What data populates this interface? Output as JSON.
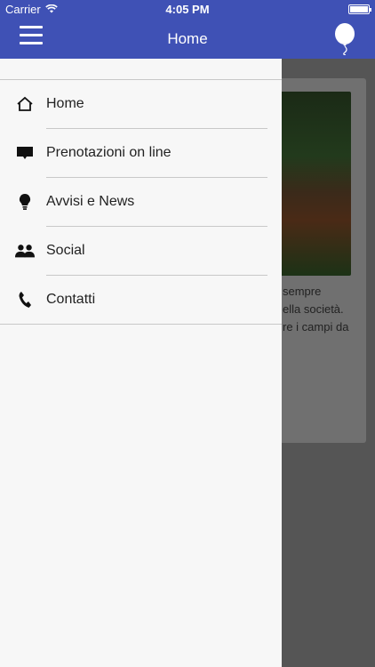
{
  "status_bar": {
    "carrier": "Carrier",
    "time": "4:05 PM"
  },
  "navbar": {
    "title": "Home"
  },
  "background_content": {
    "text_lines": [
      "sempre",
      "ella società.",
      "re i campi da"
    ]
  },
  "drawer": {
    "items": [
      {
        "label": "Home",
        "icon": "home-icon"
      },
      {
        "label": "Prenotazioni on line",
        "icon": "chat-bubble-icon"
      },
      {
        "label": "Avvisi e News",
        "icon": "lightbulb-icon"
      },
      {
        "label": "Social",
        "icon": "people-icon"
      },
      {
        "label": "Contatti",
        "icon": "phone-icon"
      }
    ]
  },
  "colors": {
    "primary": "#3f51b5",
    "drawer_bg": "#f7f7f7",
    "overlay": "#555555"
  }
}
